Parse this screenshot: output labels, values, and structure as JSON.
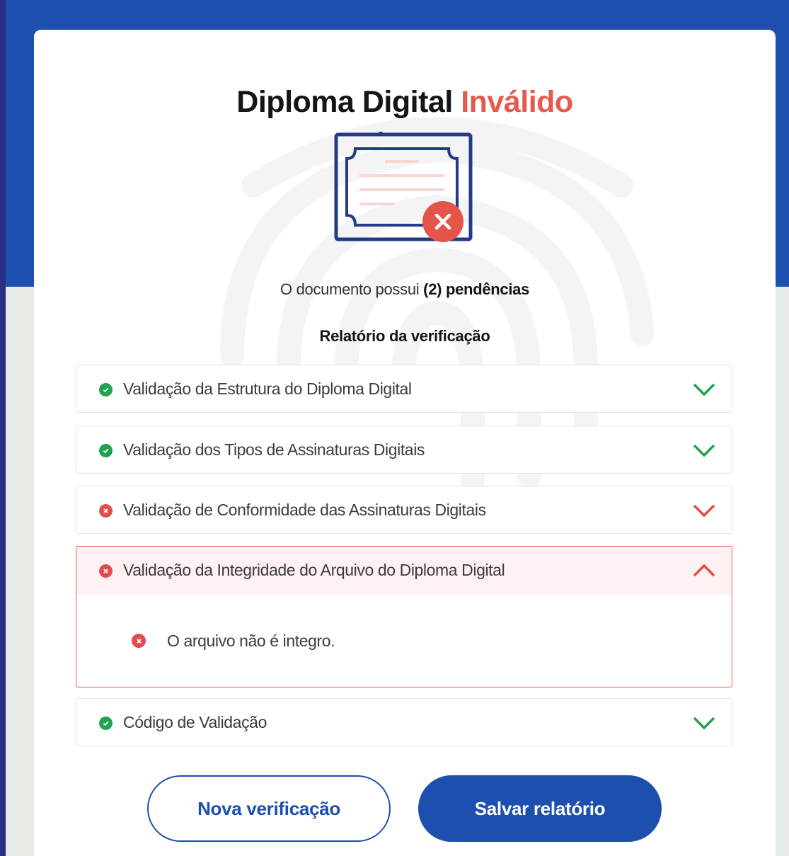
{
  "title": {
    "main": "Diploma Digital",
    "status": "Inválido"
  },
  "icons": {
    "diploma": "diploma-certificate-icon",
    "error_badge": "error-x-icon",
    "watermark": "fingerprint-icon"
  },
  "summary": {
    "prefix": "O documento possui",
    "count": "(2)",
    "suffix": "pendências"
  },
  "report_title": "Relatório da verificação",
  "checks": [
    {
      "label": "Validação da Estrutura do Diploma Digital",
      "status": "ok",
      "expanded": false
    },
    {
      "label": "Validação dos Tipos de Assinaturas Digitais",
      "status": "ok",
      "expanded": false
    },
    {
      "label": "Validação de Conformidade das Assinaturas Digitais",
      "status": "error",
      "expanded": false
    },
    {
      "label": "Validação da Integridade do Arquivo do Diploma Digital",
      "status": "error",
      "expanded": true,
      "details": [
        {
          "text": "O arquivo não é integro.",
          "status": "error"
        }
      ]
    },
    {
      "label": "Código de Validação",
      "status": "ok",
      "expanded": false
    }
  ],
  "buttons": {
    "new_verification": "Nova verificação",
    "save_report": "Salvar relatório"
  },
  "colors": {
    "brand_blue": "#1c4fae",
    "outer_bg": "#2b2d86",
    "lower_bg": "#e7ece9",
    "ok": "#22a24e",
    "error": "#e34c4c",
    "title_error": "#e35b50"
  }
}
